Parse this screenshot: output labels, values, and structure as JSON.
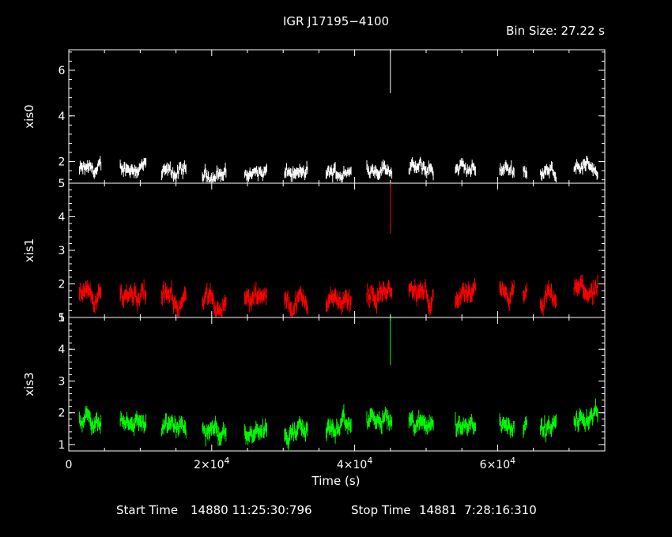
{
  "title": "IGR J17195−4100",
  "bin_size": "Bin Size: 27.22 s",
  "footer": {
    "start_label": "Start Time",
    "start_value": "14880 11:25:30:796",
    "stop_label": "Stop Time",
    "stop_value": "14881  7:28:16:310"
  },
  "chart_data": {
    "type": "scatter",
    "title": "IGR J17195−4100",
    "xlabel": "Time (s)",
    "xlim": [
      0,
      75000
    ],
    "x_ticks": [
      {
        "value": 0,
        "base": "0",
        "exp": ""
      },
      {
        "value": 20000,
        "base": "2×10",
        "exp": "4"
      },
      {
        "value": 40000,
        "base": "4×10",
        "exp": "4"
      },
      {
        "value": 60000,
        "base": "6×10",
        "exp": "4"
      }
    ],
    "panels": [
      {
        "name": "xis0",
        "ylabel": "xis0",
        "color": "#ffffff",
        "ylim": [
          1.05,
          6.9
        ],
        "ticks": [
          2,
          4,
          6
        ],
        "spike": {
          "x": 45000,
          "low": 5.0,
          "high": 6.9
        }
      },
      {
        "name": "xis1",
        "ylabel": "xis1",
        "color": "#ff0000",
        "ylim": [
          1.0,
          5.0
        ],
        "ticks": [
          1,
          2,
          3,
          4,
          5
        ],
        "spike": {
          "x": 45000,
          "low": 3.5,
          "high": 5.0
        }
      },
      {
        "name": "xis3",
        "ylabel": "xis3",
        "color": "#00ff00",
        "ylim": [
          0.8,
          5.0
        ],
        "ticks": [
          1,
          2,
          3,
          4,
          5
        ],
        "spike": {
          "x": 45000,
          "low": 3.5,
          "high": 5.0
        }
      }
    ],
    "segments": [
      {
        "start": 1500,
        "end": 4500,
        "level": 1.6
      },
      {
        "start": 7200,
        "end": 10800,
        "level": 1.75
      },
      {
        "start": 13000,
        "end": 16400,
        "level": 1.5
      },
      {
        "start": 18700,
        "end": 22000,
        "level": 1.45
      },
      {
        "start": 24600,
        "end": 27700,
        "level": 1.5
      },
      {
        "start": 30200,
        "end": 33400,
        "level": 1.45
      },
      {
        "start": 36000,
        "end": 39500,
        "level": 1.5
      },
      {
        "start": 41700,
        "end": 45200,
        "level": 1.75
      },
      {
        "start": 47600,
        "end": 51000,
        "level": 1.65
      },
      {
        "start": 54100,
        "end": 56900,
        "level": 1.6
      },
      {
        "start": 60300,
        "end": 62300,
        "level": 1.7
      },
      {
        "start": 63600,
        "end": 64100,
        "level": 1.55
      },
      {
        "start": 66000,
        "end": 68200,
        "level": 1.5
      },
      {
        "start": 70700,
        "end": 74000,
        "level": 1.8
      }
    ]
  }
}
